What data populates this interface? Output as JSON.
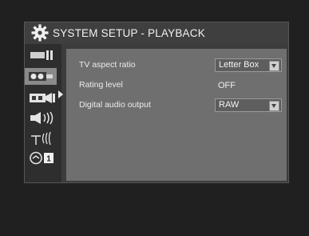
{
  "header": {
    "icon": "gear-icon",
    "title": "SYSTEM SETUP - PLAYBACK"
  },
  "sidebar": {
    "items": [
      {
        "icon": "display-icon",
        "selected": false
      },
      {
        "icon": "playback-film-icon",
        "selected": true
      },
      {
        "icon": "video-camera-icon",
        "selected": false
      },
      {
        "icon": "speaker-audio-icon",
        "selected": false
      },
      {
        "icon": "antenna-icon",
        "selected": false
      },
      {
        "icon": "parental-lock-icon",
        "selected": false,
        "badge": "1"
      }
    ]
  },
  "settings": [
    {
      "label": "TV aspect ratio",
      "value": "Letter Box",
      "type": "dropdown"
    },
    {
      "label": "Rating level",
      "value": "OFF",
      "type": "text"
    },
    {
      "label": "Digital audio output",
      "value": "RAW",
      "type": "dropdown"
    }
  ],
  "colors": {
    "panel": "#3c3c3c",
    "content": "#6f6f6f",
    "selected": "#8a8a8a",
    "text": "#ececec"
  }
}
